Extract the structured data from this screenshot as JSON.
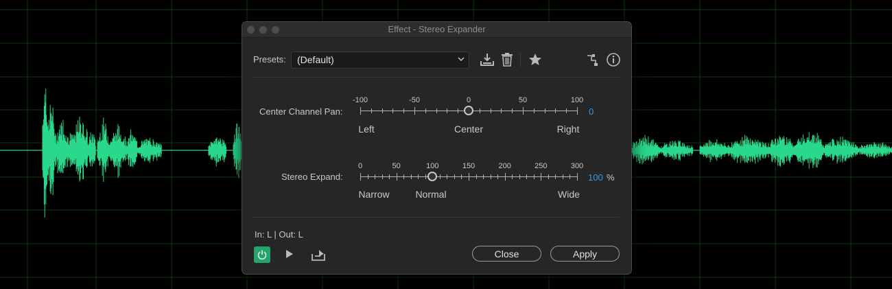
{
  "dialog": {
    "title": "Effect - Stereo Expander"
  },
  "presets": {
    "label": "Presets:",
    "value": "(Default)",
    "icons": [
      "save-preset-icon",
      "delete-preset-icon",
      "favorite-star-icon",
      "routing-icon",
      "info-icon"
    ]
  },
  "center_pan": {
    "label": "Center Channel Pan:",
    "scale_labels": [
      "-100",
      "-50",
      "0",
      "50",
      "100"
    ],
    "min": -100,
    "max": 100,
    "value_number": 0,
    "value": "0",
    "left_label": "Left",
    "center_label": "Center",
    "right_label": "Right"
  },
  "stereo_expand": {
    "label": "Stereo Expand:",
    "scale_labels": [
      "0",
      "50",
      "100",
      "150",
      "200",
      "250",
      "300"
    ],
    "min": 0,
    "max": 300,
    "value_number": 100,
    "value": "100",
    "unit": "%",
    "narrow_label": "Narrow",
    "normal_label": "Normal",
    "wide_label": "Wide"
  },
  "io": {
    "text": "In: L | Out: L"
  },
  "footer": {
    "icons": [
      "power-icon",
      "play-icon",
      "export-icon"
    ],
    "close_label": "Close",
    "apply_label": "Apply"
  },
  "colors": {
    "waveform": "#2ad88c",
    "accent_blue": "#2f9af2",
    "power_green": "#24a56b",
    "grid": "#0c3a0c"
  }
}
